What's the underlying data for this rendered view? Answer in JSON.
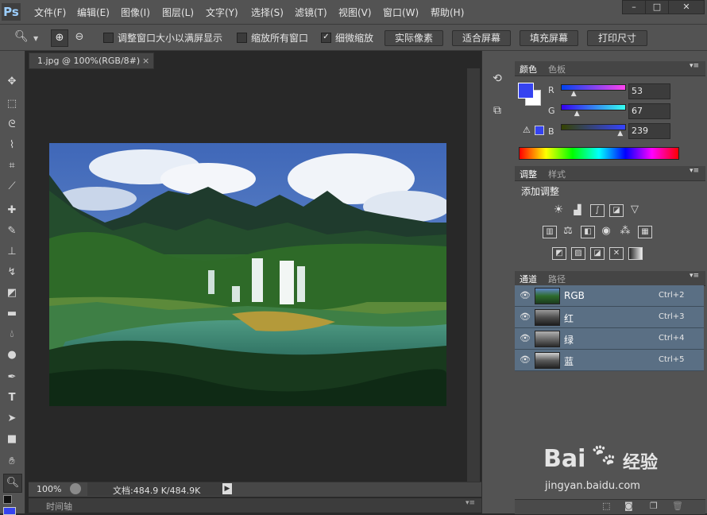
{
  "app": {
    "logo": "Ps"
  },
  "menu": [
    "文件(F)",
    "编辑(E)",
    "图像(I)",
    "图层(L)",
    "文字(Y)",
    "选择(S)",
    "滤镜(T)",
    "视图(V)",
    "窗口(W)",
    "帮助(H)"
  ],
  "window_controls": {
    "minimize": "–",
    "maximize": "□",
    "close": "✕"
  },
  "options": {
    "zoom_in_icon": "zoom-in-icon",
    "resize_windows_label": "调整窗口大小以满屏显示",
    "resize_windows_checked": false,
    "zoom_all_label": "缩放所有窗口",
    "zoom_all_checked": false,
    "scrubby_zoom_label": "细微缩放",
    "scrubby_zoom_checked": true,
    "actual_pixels": "实际像素",
    "fit_screen": "适合屏幕",
    "fill_screen": "填充屏幕",
    "print_size": "打印尺寸"
  },
  "document": {
    "tab_title": "1.jpg @ 100%(RGB/8#)",
    "tab_close": "×",
    "zoom": "100%",
    "doc_info": "文档:484.9 K/484.9K"
  },
  "timeline": {
    "label": "时间轴"
  },
  "color_panel": {
    "tabs": [
      "颜色",
      "色板"
    ],
    "foreground": "#3543f0",
    "background": "#ffffff",
    "channels": [
      {
        "label": "R",
        "value": "53",
        "fraction": 0.21
      },
      {
        "label": "G",
        "value": "67",
        "fraction": 0.26
      },
      {
        "label": "B",
        "value": "239",
        "fraction": 0.94
      }
    ]
  },
  "adjustments_panel": {
    "tabs": [
      "调整",
      "样式"
    ],
    "title": "添加调整"
  },
  "channels_panel": {
    "tabs": [
      "通道",
      "路径"
    ],
    "channels": [
      {
        "name": "RGB",
        "shortcut": "Ctrl+2"
      },
      {
        "name": "红",
        "shortcut": "Ctrl+3"
      },
      {
        "name": "绿",
        "shortcut": "Ctrl+4"
      },
      {
        "name": "蓝",
        "shortcut": "Ctrl+5"
      }
    ]
  },
  "watermark": {
    "brand": "Bai",
    "brand2": "经验",
    "url": "jingyan.baidu.com"
  }
}
